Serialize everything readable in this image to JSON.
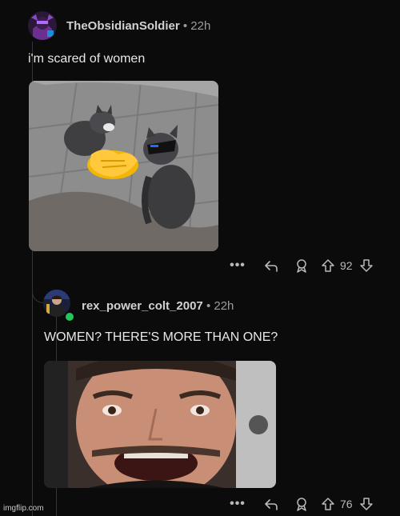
{
  "comments": [
    {
      "username": "TheObsidianSoldier",
      "separator": "•",
      "time": "22h",
      "text": "i'm scared of women",
      "media_icon": "cats-meme-image",
      "actions": {
        "more": "•••",
        "score": "92"
      }
    },
    {
      "username": "rex_power_colt_2007",
      "separator": "•",
      "time": "22h",
      "text": "WOMEN? THERE'S MORE THAN ONE?",
      "media_icon": "shocked-face-meme-image",
      "actions": {
        "more": "•••",
        "score": "76"
      }
    }
  ],
  "colors": {
    "background": "#0b0b0b",
    "online": "#22c55e",
    "thread": "#343536"
  },
  "watermark": "imgflip.com"
}
